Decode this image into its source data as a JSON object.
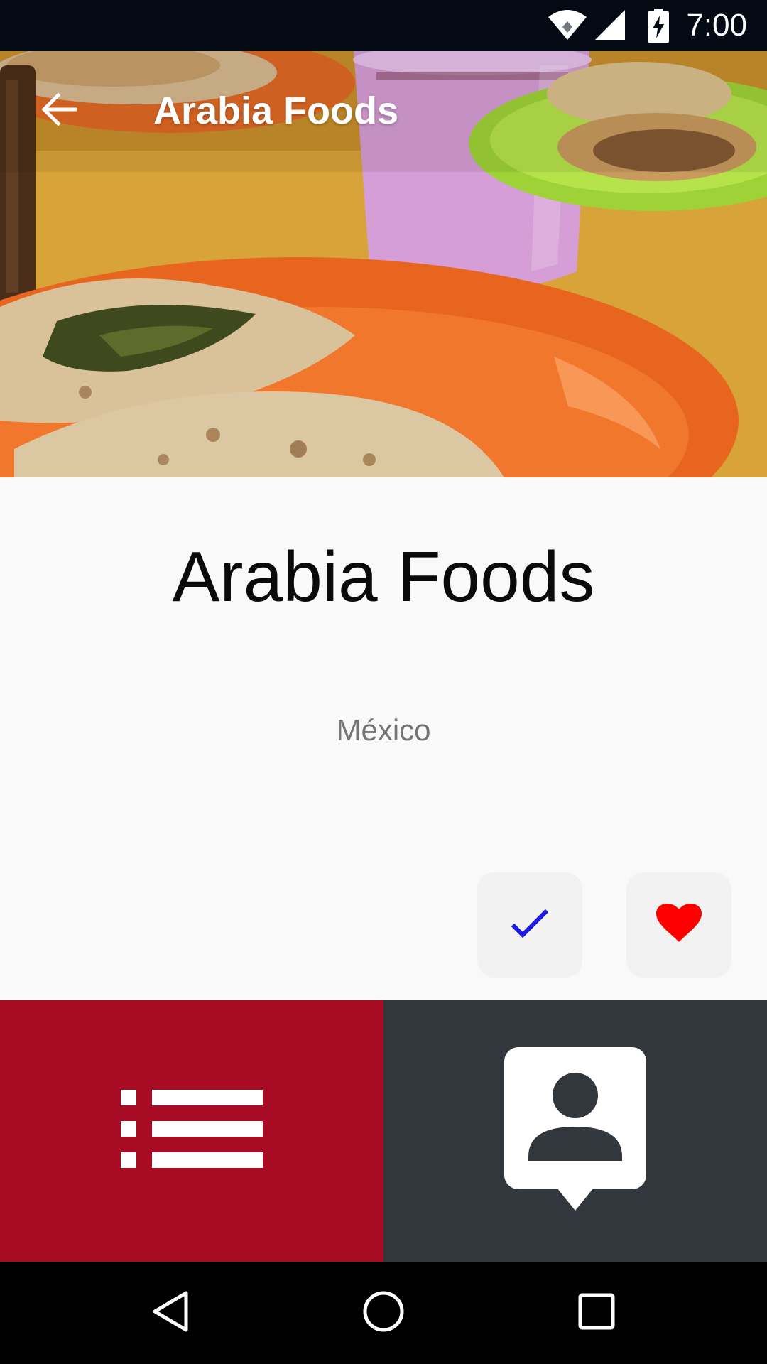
{
  "status_bar": {
    "time": "7:00",
    "icons": [
      "wifi-icon",
      "cell-signal-icon",
      "battery-charging-icon"
    ]
  },
  "toolbar": {
    "title": "Arabia Foods",
    "back_icon": "arrow-back-icon"
  },
  "place": {
    "name": "Arabia Foods",
    "location": "México",
    "hero_image": "food-photo"
  },
  "actions": {
    "visited_icon": "check-icon",
    "favorite_icon": "heart-icon",
    "visited_color": "#1a1ae6",
    "favorite_color": "#ff0000"
  },
  "tabs": [
    {
      "id": "list",
      "icon": "list-icon",
      "color": "#a80c24",
      "selected": true
    },
    {
      "id": "profile",
      "icon": "contact-card-icon",
      "color": "#32363d",
      "selected": false
    }
  ],
  "nav_bar": {
    "icons": [
      "nav-back-icon",
      "nav-home-icon",
      "nav-recents-icon"
    ]
  }
}
